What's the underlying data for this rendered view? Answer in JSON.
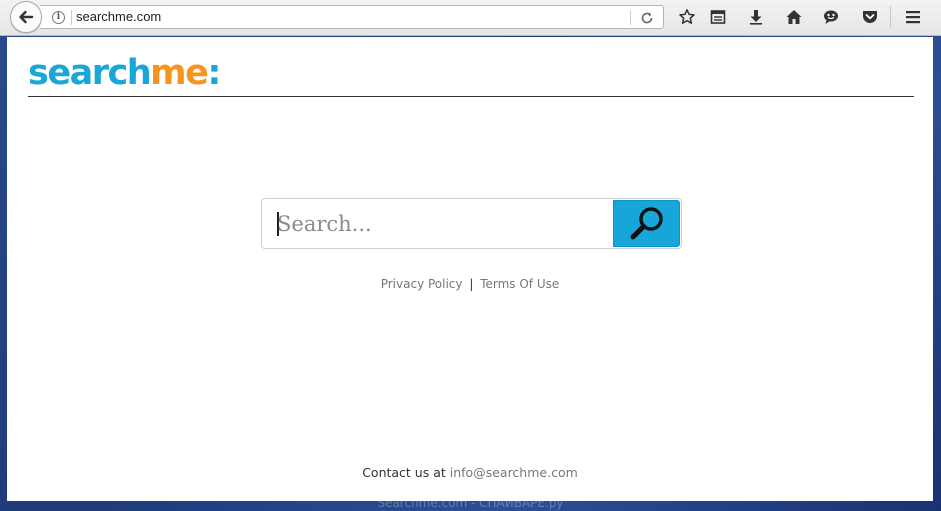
{
  "browser": {
    "url": "searchme.com",
    "toolbar_icons": [
      "back-arrow-icon",
      "info-icon",
      "reload-icon",
      "star-icon",
      "reading-list-icon",
      "download-icon",
      "home-icon",
      "chat-icon",
      "pocket-icon",
      "hamburger-menu-icon"
    ]
  },
  "logo": {
    "part1": "search",
    "part2": "me",
    "part3": ":"
  },
  "search": {
    "placeholder": "Search...",
    "button_icon": "search-icon"
  },
  "footer_links": {
    "privacy": "Privacy Policy",
    "separator": "|",
    "terms": "Terms Of Use"
  },
  "contact": {
    "prefix": "Contact us at",
    "email": "info@searchme.com"
  },
  "watermark": "Searchme.com - СПАЙВАРЕ.ру",
  "colors": {
    "brand_blue": "#1aa6d6",
    "brand_orange": "#f7941d",
    "search_button": "#17a6d9"
  }
}
